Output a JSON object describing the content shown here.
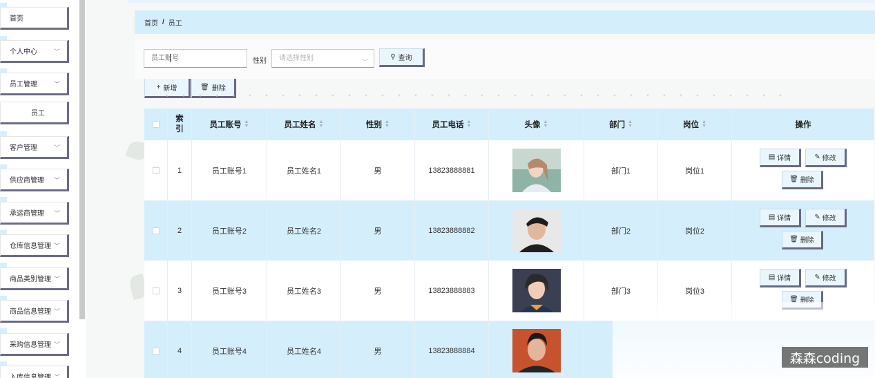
{
  "sidebar": {
    "items": [
      {
        "label": "首页",
        "expandable": false
      },
      {
        "label": "个人中心",
        "expandable": true
      },
      {
        "label": "员工管理",
        "expandable": true
      },
      {
        "label": "员工",
        "expandable": false,
        "sub": true
      },
      {
        "label": "客户管理",
        "expandable": true
      },
      {
        "label": "供应商管理",
        "expandable": true
      },
      {
        "label": "承运商管理",
        "expandable": true
      },
      {
        "label": "仓库信息管理",
        "expandable": true
      },
      {
        "label": "商品类别管理",
        "expandable": true
      },
      {
        "label": "商品信息管理",
        "expandable": true
      },
      {
        "label": "采购信息管理",
        "expandable": true
      },
      {
        "label": "入库信息管理",
        "expandable": true
      }
    ]
  },
  "breadcrumb": {
    "home": "首页",
    "separator": "/",
    "current": "员工"
  },
  "search": {
    "account_placeholder": "员工账号",
    "gender_label": "性别",
    "gender_placeholder": "请选择性别",
    "query_label": "查询"
  },
  "toolbar": {
    "add_label": "新增",
    "delete_label": "删除"
  },
  "table": {
    "headers": {
      "index": "索引",
      "account": "员工账号",
      "name": "员工姓名",
      "gender": "性别",
      "phone": "员工电话",
      "avatar": "头像",
      "department": "部门",
      "position": "岗位",
      "actions": "操作"
    },
    "action_labels": {
      "detail": "详情",
      "edit": "修改",
      "delete": "删除"
    },
    "rows": [
      {
        "index": "1",
        "account": "员工账号1",
        "name": "员工姓名1",
        "gender": "男",
        "phone": "13823888881",
        "department": "部门1",
        "position": "岗位1"
      },
      {
        "index": "2",
        "account": "员工账号2",
        "name": "员工姓名2",
        "gender": "男",
        "phone": "13823888882",
        "department": "部门2",
        "position": "岗位2"
      },
      {
        "index": "3",
        "account": "员工账号3",
        "name": "员工姓名3",
        "gender": "男",
        "phone": "13823888883",
        "department": "部门3",
        "position": "岗位3"
      },
      {
        "index": "4",
        "account": "员工账号4",
        "name": "员工姓名4",
        "gender": "男",
        "phone": "13823888884",
        "department": "",
        "position": ""
      }
    ]
  },
  "watermark": "森森coding",
  "colors": {
    "accent_bg": "#d5eefc",
    "button_shadow": "#666884",
    "sidebar_bg": "#ffffff"
  }
}
